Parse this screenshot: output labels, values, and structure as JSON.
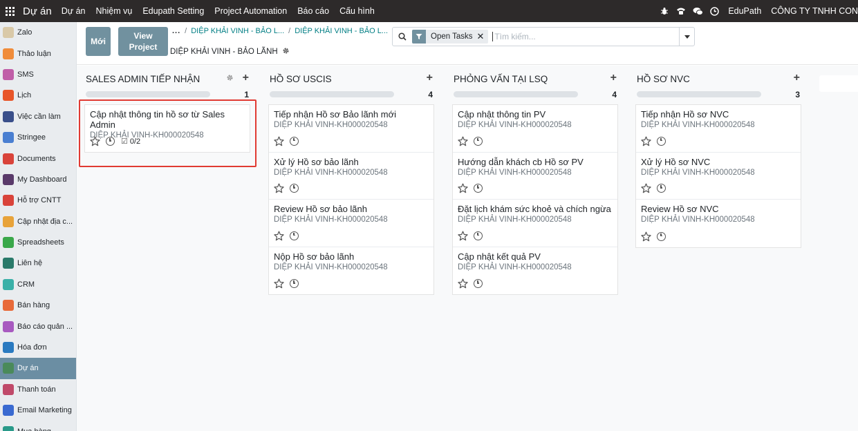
{
  "navbar": {
    "brand": "Dự án",
    "menu": [
      "Dự án",
      "Nhiệm vụ",
      "Edupath Setting",
      "Project Automation",
      "Báo cáo",
      "Cấu hình"
    ],
    "company_short": "EduPath",
    "company_name": "CÔNG TY TNHH CON"
  },
  "sidebar": {
    "items": [
      {
        "label": "Zalo",
        "color": "#d9c9a8"
      },
      {
        "label": "Thảo luận",
        "color": "#f08c3a"
      },
      {
        "label": "SMS",
        "color": "#c05ea8"
      },
      {
        "label": "Lịch",
        "color": "#e8562a"
      },
      {
        "label": "Việc cần làm",
        "color": "#3a4f8a"
      },
      {
        "label": "Stringee",
        "color": "#4a7fd1"
      },
      {
        "label": "Documents",
        "color": "#d9433a"
      },
      {
        "label": "My Dashboard",
        "color": "#5a3a6a"
      },
      {
        "label": "Hỗ trợ CNTT",
        "color": "#d9433a"
      },
      {
        "label": "Cập nhật địa c...",
        "color": "#e8a33a"
      },
      {
        "label": "Spreadsheets",
        "color": "#3aa84a"
      },
      {
        "label": "Liên hệ",
        "color": "#2a7a6a"
      },
      {
        "label": "CRM",
        "color": "#3ab0a8"
      },
      {
        "label": "Bán hàng",
        "color": "#e86a3a"
      },
      {
        "label": "Báo cáo quản ...",
        "color": "#a85ac0"
      },
      {
        "label": "Hóa đơn",
        "color": "#2a7ac0"
      },
      {
        "label": "Dự án",
        "color": "#4a8a5a",
        "active": true
      },
      {
        "label": "Thanh toán",
        "color": "#c04a6a"
      },
      {
        "label": "Email Marketing",
        "color": "#3a6ad1"
      },
      {
        "label": "Mua hàng",
        "color": "#2a9a8a"
      }
    ]
  },
  "control": {
    "new_label": "Mới",
    "view_label_1": "View",
    "view_label_2": "Project",
    "breadcrumb_dots": "...",
    "breadcrumb_1": "DIỆP KHẢI VINH - BẢO L...",
    "breadcrumb_2": "DIỆP KHẢI VINH - BẢO L...",
    "current": "DIỆP KHẢI VINH - BẢO LÃNH",
    "facet": "Open Tasks",
    "search_placeholder": "Tìm kiếm..."
  },
  "columns": [
    {
      "title": "SALES ADMIN TIẾP NHẬN",
      "count": "1",
      "cards": [
        {
          "title": "Cập nhật thông tin hồ sơ từ Sales Admin",
          "sub": "DIỆP KHẢI VINH-KH000020548",
          "checklist": "0/2"
        }
      ]
    },
    {
      "title": "HỒ SƠ USCIS",
      "count": "4",
      "cards": [
        {
          "title": "Tiếp nhận Hồ sơ Bảo lãnh mới",
          "sub": "DIỆP KHẢI VINH-KH000020548"
        },
        {
          "title": "Xử lý Hồ sơ bảo lãnh",
          "sub": "DIỆP KHẢI VINH-KH000020548"
        },
        {
          "title": "Review Hồ sơ bảo lãnh",
          "sub": "DIỆP KHẢI VINH-KH000020548"
        },
        {
          "title": "Nộp Hồ sơ bảo lãnh",
          "sub": "DIỆP KHẢI VINH-KH000020548"
        }
      ]
    },
    {
      "title": "PHỎNG VẤN TẠI LSQ",
      "count": "4",
      "cards": [
        {
          "title": "Cập nhật thông tin PV",
          "sub": "DIỆP KHẢI VINH-KH000020548"
        },
        {
          "title": "Hướng dẫn khách cb Hồ sơ PV",
          "sub": "DIỆP KHẢI VINH-KH000020548"
        },
        {
          "title": "Đặt lịch khám sức khoẻ và chích ngừa",
          "sub": "DIỆP KHẢI VINH-KH000020548"
        },
        {
          "title": "Cập nhật kết quả PV",
          "sub": "DIỆP KHẢI VINH-KH000020548"
        }
      ]
    },
    {
      "title": "HỒ SƠ NVC",
      "count": "3",
      "cards": [
        {
          "title": "Tiếp nhận Hồ sơ NVC",
          "sub": "DIỆP KHẢI VINH-KH000020548"
        },
        {
          "title": "Xử lý Hồ sơ NVC",
          "sub": "DIỆP KHẢI VINH-KH000020548"
        },
        {
          "title": "Review Hồ sơ NVC",
          "sub": "DIỆP KHẢI VINH-KH000020548"
        }
      ]
    }
  ]
}
